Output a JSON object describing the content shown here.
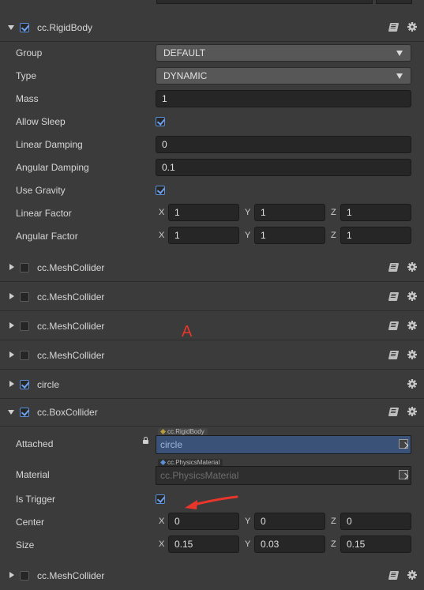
{
  "rigidbody": {
    "title": "cc.RigidBody",
    "props": {
      "group": {
        "label": "Group",
        "value": "DEFAULT"
      },
      "type": {
        "label": "Type",
        "value": "DYNAMIC"
      },
      "mass": {
        "label": "Mass",
        "value": "1"
      },
      "allow_sleep": {
        "label": "Allow Sleep",
        "checked": true
      },
      "linear_damping": {
        "label": "Linear Damping",
        "value": "0"
      },
      "angular_damping": {
        "label": "Angular Damping",
        "value": "0.1"
      },
      "use_gravity": {
        "label": "Use Gravity",
        "checked": true
      },
      "linear_factor": {
        "label": "Linear Factor",
        "x": "1",
        "y": "1",
        "z": "1"
      },
      "angular_factor": {
        "label": "Angular Factor",
        "x": "1",
        "y": "1",
        "z": "1"
      }
    }
  },
  "axis_labels": {
    "x": "X",
    "y": "Y",
    "z": "Z"
  },
  "collapsed_components": [
    {
      "title": "cc.MeshCollider",
      "enabled": false
    },
    {
      "title": "cc.MeshCollider",
      "enabled": false
    },
    {
      "title": "cc.MeshCollider",
      "enabled": false
    },
    {
      "title": "cc.MeshCollider",
      "enabled": false
    },
    {
      "title": "circle",
      "enabled": true
    }
  ],
  "boxcollider": {
    "title": "cc.BoxCollider",
    "props": {
      "attached": {
        "label": "Attached",
        "type_tag": "cc.RigidBody",
        "value": "circle"
      },
      "material": {
        "label": "Material",
        "type_tag": "cc.PhysicsMaterial",
        "placeholder": "cc.PhysicsMaterial"
      },
      "is_trigger": {
        "label": "Is Trigger",
        "checked": true
      },
      "center": {
        "label": "Center",
        "x": "0",
        "y": "0",
        "z": "0"
      },
      "size": {
        "label": "Size",
        "x": "0.15",
        "y": "0.03",
        "z": "0.15"
      }
    }
  },
  "bottom_partial": {
    "title": "cc.MeshCollider"
  },
  "annotation": {
    "letter": "A",
    "color": "#e8362b"
  },
  "colors": {
    "accent_blue": "#5b8fd8",
    "panel_bg": "#3b3b3b",
    "field_bg": "#262626",
    "ref_fill": "#3a5278"
  },
  "icons": {
    "component_help": "book-icon",
    "component_settings": "gear-icon"
  }
}
